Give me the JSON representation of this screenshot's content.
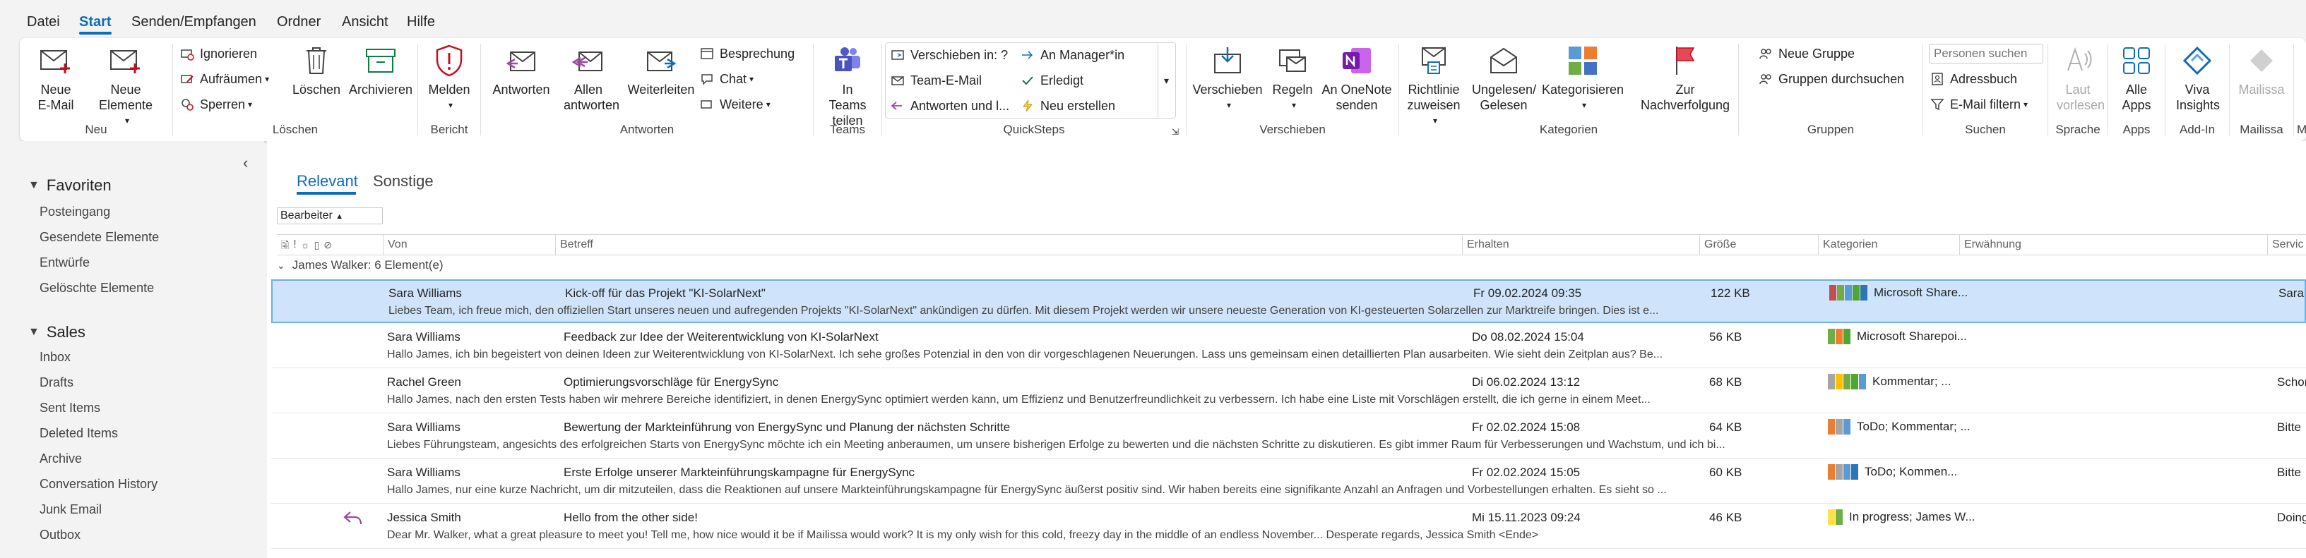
{
  "menu": {
    "items": [
      "Datei",
      "Start",
      "Senden/Empfangen",
      "Ordner",
      "Ansicht",
      "Hilfe"
    ]
  },
  "ribbon": {
    "neu": {
      "label": "Neu",
      "new_email": "Neue E-Mail",
      "new_items": "Neue Elemente"
    },
    "loeschen": {
      "label": "Löschen",
      "ignore": "Ignorieren",
      "cleanup": "Aufräumen",
      "block": "Sperren",
      "delete": "Löschen",
      "archive": "Archivieren"
    },
    "bericht": {
      "label": "Bericht",
      "report": "Melden"
    },
    "antworten": {
      "label": "Antworten",
      "reply": "Antworten",
      "reply_all": "Allen antworten",
      "forward": "Weiterleiten",
      "meeting": "Besprechung",
      "chat": "Chat",
      "more": "Weitere"
    },
    "teams": {
      "label": "Teams",
      "share": "In Teams teilen"
    },
    "quicksteps": {
      "label": "QuickSteps",
      "moveto": "Verschieben in: ?",
      "manager": "An Manager*in",
      "team_email": "Team-E-Mail",
      "done": "Erledigt",
      "reply_delete": "Antworten und l...",
      "create_new": "Neu erstellen"
    },
    "verschieben": {
      "label": "Verschieben",
      "move": "Verschieben",
      "rules": "Regeln",
      "onenote": "An OneNote senden"
    },
    "kategorien": {
      "label": "Kategorien",
      "policy": "Richtlinie zuweisen",
      "unread": "Ungelesen/ Gelesen",
      "categorize": "Kategorisieren",
      "followup": "Zur Nachverfolgung"
    },
    "gruppen": {
      "label": "Gruppen",
      "new_group": "Neue Gruppe",
      "browse_groups": "Gruppen durchsuchen"
    },
    "suchen": {
      "label": "Suchen",
      "search_placeholder": "Personen suchen",
      "address_book": "Adressbuch",
      "filter_email": "E-Mail filtern"
    },
    "sprache": {
      "label": "Sprache",
      "read_aloud": "Laut vorlesen"
    },
    "apps": {
      "label": "Apps",
      "all_apps": "Alle Apps"
    },
    "addin": {
      "label": "Add-In",
      "viva": "Viva Insights"
    },
    "mailissa": {
      "label": "Mailissa",
      "mailissa_btn": "Mailissa",
      "cut": "M"
    }
  },
  "sidebar": {
    "favorites": {
      "title": "Favoriten",
      "items": [
        "Posteingang",
        "Gesendete Elemente",
        "Entwürfe",
        "Gelöschte Elemente"
      ]
    },
    "sales": {
      "title": "Sales",
      "items": [
        "Inbox",
        "Drafts",
        "Sent Items",
        "Deleted Items",
        "Archive",
        "Conversation History",
        "Junk Email",
        "Outbox"
      ]
    }
  },
  "list": {
    "tabs": [
      "Relevant",
      "Sonstige"
    ],
    "filter_label": "Bearbeiter",
    "columns": {
      "from": "Von",
      "subject": "Betreff",
      "received": "Erhalten",
      "size": "Größe",
      "categories": "Kategorien",
      "mention": "Erwähnung",
      "service": "Servic"
    },
    "group_header": "James Walker: 6 Element(e)",
    "messages": [
      {
        "from": "Sara Williams",
        "subject": "Kick-off für das Projekt \"KI-SolarNext\"",
        "preview": "Liebes Team,  ich freue mich, den offiziellen Start unseres neuen und aufregenden Projekts \"KI-SolarNext\" ankündigen zu dürfen. Mit diesem Projekt werden wir unsere neueste Generation von KI-gesteuerten Solarzellen zur Marktreife bringen. Dies ist e...",
        "date": "Fr 09.02.2024 09:35",
        "size": "122 KB",
        "categories": "Microsoft Share...",
        "colors": [
          "#c0504d",
          "#70ad47",
          "#5b9bd5",
          "#4ea72e",
          "#2e75b6"
        ],
        "service": "Sara W",
        "selected": true,
        "replied": false
      },
      {
        "from": "Sara Williams",
        "subject": "Feedback zur Idee der Weiterentwicklung von KI-SolarNext",
        "preview": "Hallo James,  ich bin begeistert von deinen Ideen zur Weiterentwicklung von KI-SolarNext. Ich sehe großes Potenzial in den von dir vorgeschlagenen Neuerungen. Lass uns gemeinsam einen detaillierten Plan ausarbeiten.  Wie sieht dein Zeitplan aus?  Be...",
        "date": "Do 08.02.2024 15:04",
        "size": "56 KB",
        "categories": "Microsoft Sharepoi...",
        "colors": [
          "#70ad47",
          "#ed7d31",
          "#4ea72e"
        ],
        "service": "",
        "selected": false,
        "replied": false
      },
      {
        "from": "Rachel Green",
        "subject": "Optimierungsvorschläge für EnergySync",
        "preview": "Hallo James,  nach den ersten Tests haben wir mehrere Bereiche identifiziert, in denen EnergySync optimiert werden kann, um Effizienz und Benutzerfreundlichkeit zu verbessern. Ich habe eine Liste mit Vorschlägen erstellt, die ich gerne in einem Meet...",
        "date": "Di 06.02.2024 13:12",
        "size": "68 KB",
        "categories": "Kommentar; ...",
        "colors": [
          "#a5a5a5",
          "#ffc000",
          "#70ad47",
          "#4ea72e",
          "#5b9bd5"
        ],
        "service": "Schon",
        "selected": false,
        "replied": false
      },
      {
        "from": "Sara Williams",
        "subject": "Bewertung der Markteinführung von EnergySync und Planung der nächsten Schritte",
        "preview": "Liebes Führungsteam,  angesichts des erfolgreichen Starts von EnergySync möchte ich ein Meeting anberaumen, um unsere bisherigen Erfolge zu bewerten und die nächsten Schritte zu diskutieren. Es gibt immer Raum für Verbesserungen und Wachstum, und ich bi...",
        "date": "Fr 02.02.2024 15:08",
        "size": "64 KB",
        "categories": "ToDo; Kommentar; ...",
        "colors": [
          "#ed7d31",
          "#a5a5a5",
          "#5b9bd5"
        ],
        "service": "Bitte",
        "selected": false,
        "replied": false
      },
      {
        "from": "Sara Williams",
        "subject": "Erste Erfolge unserer Markteinführungskampagne für EnergySync",
        "preview": "Hallo James,  nur eine kurze Nachricht, um dir mitzuteilen, dass die Reaktionen auf unsere Markteinführungskampagne für EnergySync äußerst positiv sind. Wir haben bereits eine signifikante Anzahl an Anfragen und Vorbestellungen erhalten.  Es sieht so ...",
        "date": "Fr 02.02.2024 15:05",
        "size": "60 KB",
        "categories": "ToDo; Kommen...",
        "colors": [
          "#ed7d31",
          "#a5a5a5",
          "#5b9bd5",
          "#2e75b6"
        ],
        "service": "Bitte",
        "selected": false,
        "replied": false
      },
      {
        "from": "Jessica Smith",
        "subject": "Hello from the other side!",
        "preview": "Dear Mr. Walker,  what a great pleasure to meet you! Tell me, how nice would it be if Mailissa would work? It is my only wish for this cold, freezy day in the middle of an endless November...  Desperate regards,  Jessica Smith <Ende>",
        "date": "Mi 15.11.2023 09:24",
        "size": "46 KB",
        "categories": "In progress; James W...",
        "colors": [
          "#ffe14d",
          "#70ad47"
        ],
        "service": "Doing",
        "selected": false,
        "replied": true
      }
    ]
  },
  "colors": {
    "accent": "#0f6cbd",
    "selected_row": "#cfe4fa"
  }
}
